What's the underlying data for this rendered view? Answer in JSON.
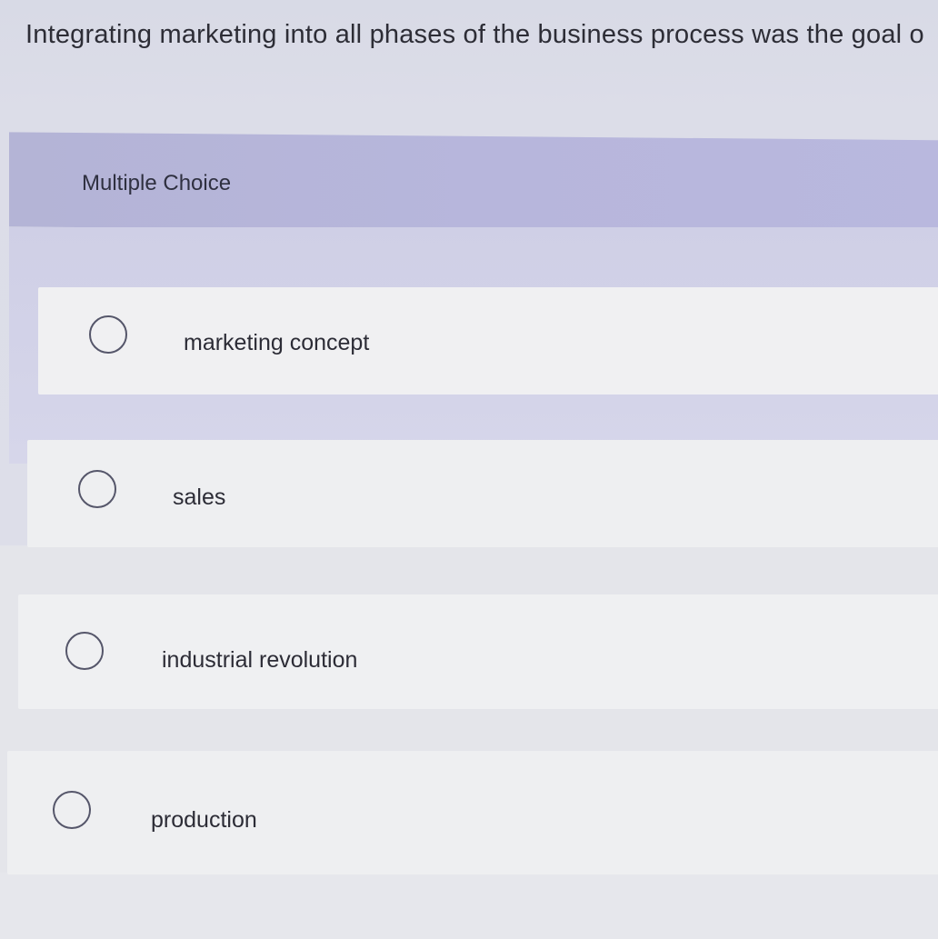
{
  "question": {
    "text": "Integrating marketing into all phases of the business process was the goal o"
  },
  "question_type": "Multiple Choice",
  "options": [
    {
      "label": "marketing concept",
      "selected": false
    },
    {
      "label": "sales",
      "selected": false
    },
    {
      "label": "industrial revolution",
      "selected": false
    },
    {
      "label": "production",
      "selected": false
    }
  ],
  "colors": {
    "header_band": "#b6b5da",
    "option_bg": "#f0f0f2",
    "page_bg": "#dcdde8",
    "radio_border": "#55566a"
  }
}
